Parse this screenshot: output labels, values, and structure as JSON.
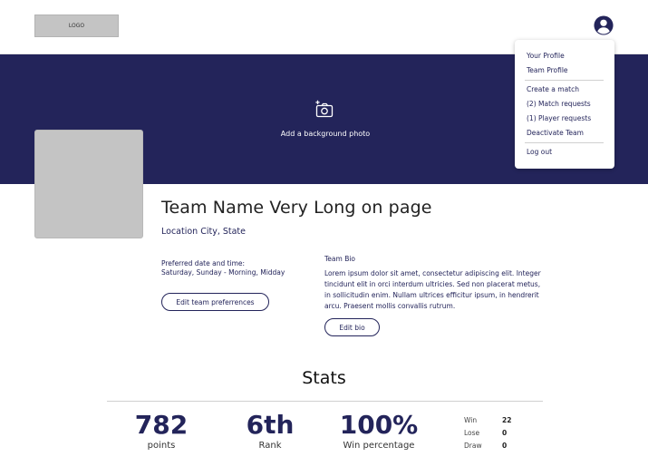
{
  "header": {
    "logo_text": "LOGO",
    "avatar_icon": "user-circle-icon"
  },
  "banner": {
    "camera_icon": "add-photo-icon",
    "add_photo_label": "Add a background photo",
    "color": "#23245a"
  },
  "menu": {
    "items": [
      {
        "label": "Your Profile"
      },
      {
        "label": "Team Profile"
      },
      {
        "label": "Create a match"
      },
      {
        "label": "(2) Match requests"
      },
      {
        "label": "(1) Player requests"
      },
      {
        "label": "Deactivate Team"
      },
      {
        "label": "Log out"
      }
    ]
  },
  "team": {
    "name": "Team Name Very Long on page",
    "location": "Location City, State",
    "preferred_label": "Preferred date and time:",
    "preferred_value": "Saturday, Sunday - Morning, Midday",
    "edit_pref_label": "Edit team preferrences",
    "bio_label": "Team Bio",
    "bio_text": "Lorem ipsum dolor sit amet, consectetur adipiscing elit. Integer tincidunt elit in orci interdum ultricies. Sed non placerat metus, in sollicitudin enim. Nullam ultrices efficitur ipsum, in hendrerit arcu. Praesent mollis convallis rutrum.",
    "edit_bio_label": "Edit bio"
  },
  "stats": {
    "title": "Stats",
    "items": [
      {
        "value": "782",
        "label": "points"
      },
      {
        "value": "6th",
        "label": "Rank"
      },
      {
        "value": "100%",
        "label": "Win percentage"
      }
    ],
    "record": [
      {
        "label": "Win",
        "value": "22"
      },
      {
        "label": "Lose",
        "value": "0"
      },
      {
        "label": "Draw",
        "value": "0"
      }
    ]
  }
}
